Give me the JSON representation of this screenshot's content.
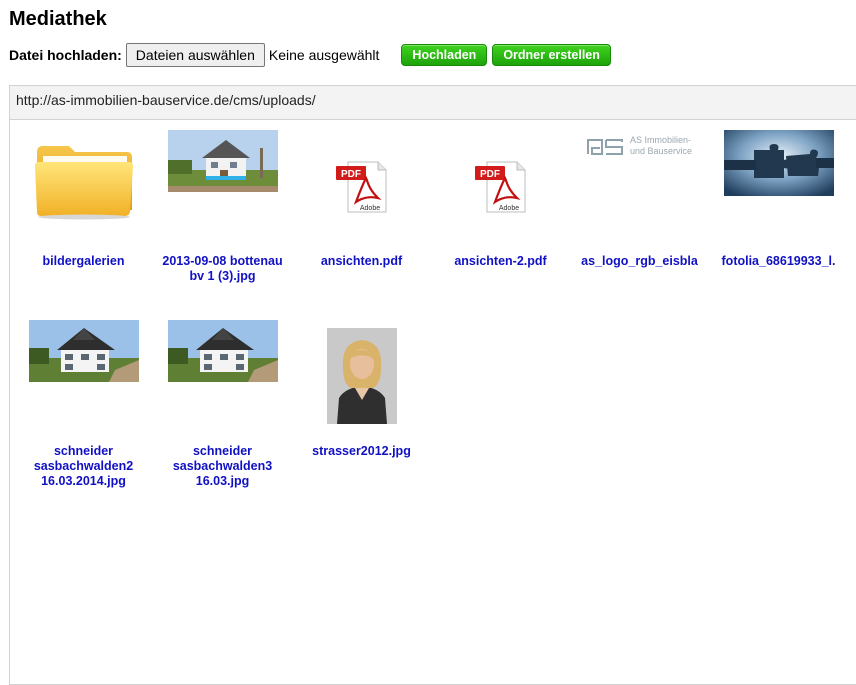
{
  "page": {
    "title": "Mediathek"
  },
  "upload": {
    "label": "Datei hochladen:",
    "choose_button": "Dateien auswählen",
    "status": "Keine ausgewählt",
    "upload_button": "Hochladen",
    "create_folder_button": "Ordner erstellen"
  },
  "browser": {
    "path": "http://as-immobilien-bauservice.de/cms/uploads/",
    "items": [
      {
        "name": "bildergalerien",
        "type": "folder",
        "icon": "folder-icon"
      },
      {
        "name": "2013-09-08 bottenau bv 1 (3).jpg",
        "type": "image",
        "icon": "house-photo"
      },
      {
        "name": "ansichten.pdf",
        "type": "pdf",
        "icon": "pdf-icon"
      },
      {
        "name": "ansichten-2.pdf",
        "type": "pdf",
        "icon": "pdf-icon"
      },
      {
        "name": "as_logo_rgb_eisbla",
        "type": "image",
        "icon": "logo-image",
        "logo_line1": "AS Immobilien-",
        "logo_line2": "und Bauservice"
      },
      {
        "name": "fotolia_68619933_l.",
        "type": "image",
        "icon": "puzzle-photo"
      },
      {
        "name": "schneider sasbachwalden2 16.03.2014.jpg",
        "type": "image",
        "icon": "house-photo"
      },
      {
        "name": "schneider sasbachwalden3 16.03.jpg",
        "type": "image",
        "icon": "house-photo"
      },
      {
        "name": "strasser2012.jpg",
        "type": "image",
        "icon": "portrait-photo"
      }
    ]
  },
  "colors": {
    "link": "#1111c4",
    "button_green": "#22b10f"
  }
}
